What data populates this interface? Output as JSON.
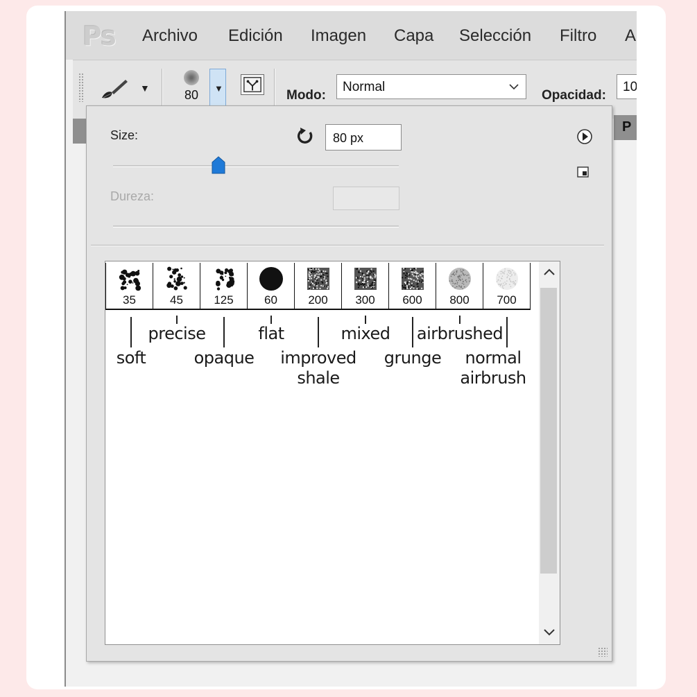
{
  "app": {
    "logo": "Ps"
  },
  "menu": [
    "Archivo",
    "Edición",
    "Imagen",
    "Capa",
    "Selección",
    "Filtro",
    "A"
  ],
  "options_bar": {
    "brush_size": "80",
    "mode_label": "Modo:",
    "mode_value": "Normal",
    "opacity_label": "Opacidad:",
    "opacity_value": "10",
    "panel_tab": "P"
  },
  "brush_popup": {
    "size_label": "Size:",
    "size_value": "80 px",
    "size_slider_fraction": 0.37,
    "hardness_label": "Dureza:",
    "hardness_value": ""
  },
  "presets": [
    {
      "size": "35",
      "name": "soft"
    },
    {
      "size": "45",
      "name": "precise"
    },
    {
      "size": "125",
      "name": "opaque"
    },
    {
      "size": "60",
      "name": "flat"
    },
    {
      "size": "200",
      "name": "improved shale"
    },
    {
      "size": "300",
      "name": "mixed"
    },
    {
      "size": "600",
      "name": "grunge"
    },
    {
      "size": "800",
      "name": "airbrushed"
    },
    {
      "size": "700",
      "name": "normal airbrush"
    }
  ],
  "colors": {
    "accent": "#1f7ad8",
    "panel": "#e4e4e4",
    "menubar": "#dcdcdc"
  }
}
